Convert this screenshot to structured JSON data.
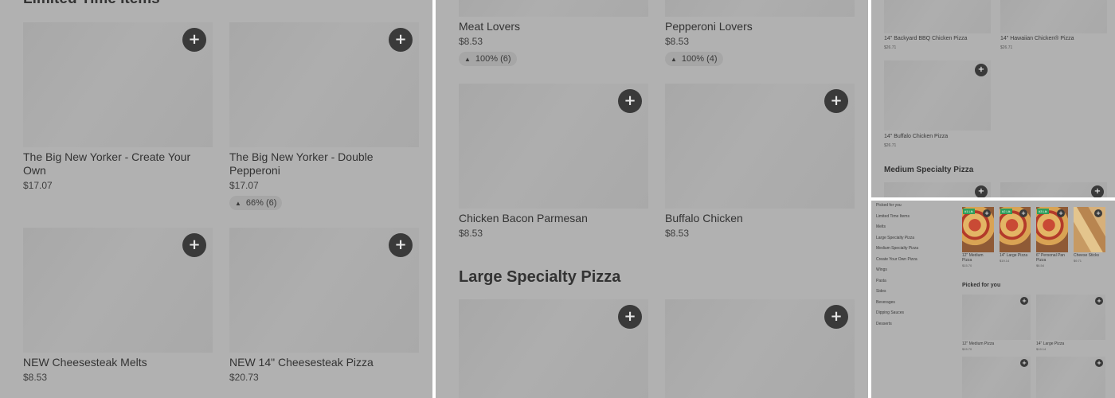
{
  "panel1": {
    "section_title": "Limited Time Items",
    "items": [
      {
        "name": "The Big New Yorker - Create Your Own",
        "price": "$17.07"
      },
      {
        "name": "The Big New Yorker - Double Pepperoni",
        "price": "$17.07",
        "rating": "66% (6)"
      },
      {
        "name": "NEW Cheesesteak Melts",
        "price": "$8.53"
      },
      {
        "name": "NEW 14\" Cheesesteak Pizza",
        "price": "$20.73"
      }
    ]
  },
  "panel2": {
    "items_top": [
      {
        "name": "Meat Lovers",
        "price": "$8.53",
        "rating": "100% (6)"
      },
      {
        "name": "Pepperoni Lovers",
        "price": "$8.53",
        "rating": "100% (4)"
      }
    ],
    "items_mid": [
      {
        "name": "Chicken Bacon Parmesan",
        "price": "$8.53"
      },
      {
        "name": "Buffalo Chicken",
        "price": "$8.53"
      }
    ],
    "section_title": "Large Specialty Pizza"
  },
  "panel3": {
    "items": [
      {
        "name": "14\" Backyard BBQ Chicken Pizza",
        "price": "$26.71"
      },
      {
        "name": "14\" Hawaiian Chicken® Pizza",
        "price": "$26.71"
      },
      {
        "name": "14\" Buffalo Chicken Pizza",
        "price": "$26.71"
      }
    ],
    "section_title": "Medium Specialty Pizza"
  },
  "panel4": {
    "sidebar": [
      "Picked for you",
      "Limited Time Items",
      "Melts",
      "Large Specialty Pizza",
      "Medium Specialty Pizza",
      "Create Your Own Pizza",
      "Wings",
      "Pasta",
      "Sides",
      "Beverages",
      "Dipping Sauces",
      "Desserts"
    ],
    "featured": [
      {
        "name": "12\" Medium Pizza",
        "price": "$15.70",
        "tag": "#1 Lik"
      },
      {
        "name": "14\" Large Pizza",
        "price": "$19.14",
        "tag": "#2 Lik"
      },
      {
        "name": "6\" Personal Pan Pizza",
        "price": "$6.54",
        "tag": "#3 Lik"
      },
      {
        "name": "Cheese Sticks",
        "price": "$9.71"
      }
    ],
    "section_title": "Picked for you",
    "picked": [
      {
        "name": "12\" Medium Pizza",
        "price": "$15.70"
      },
      {
        "name": "14\" Large Pizza",
        "price": "$19.14"
      }
    ]
  },
  "icons": {
    "add": "+",
    "thumbs_up": "👍"
  }
}
